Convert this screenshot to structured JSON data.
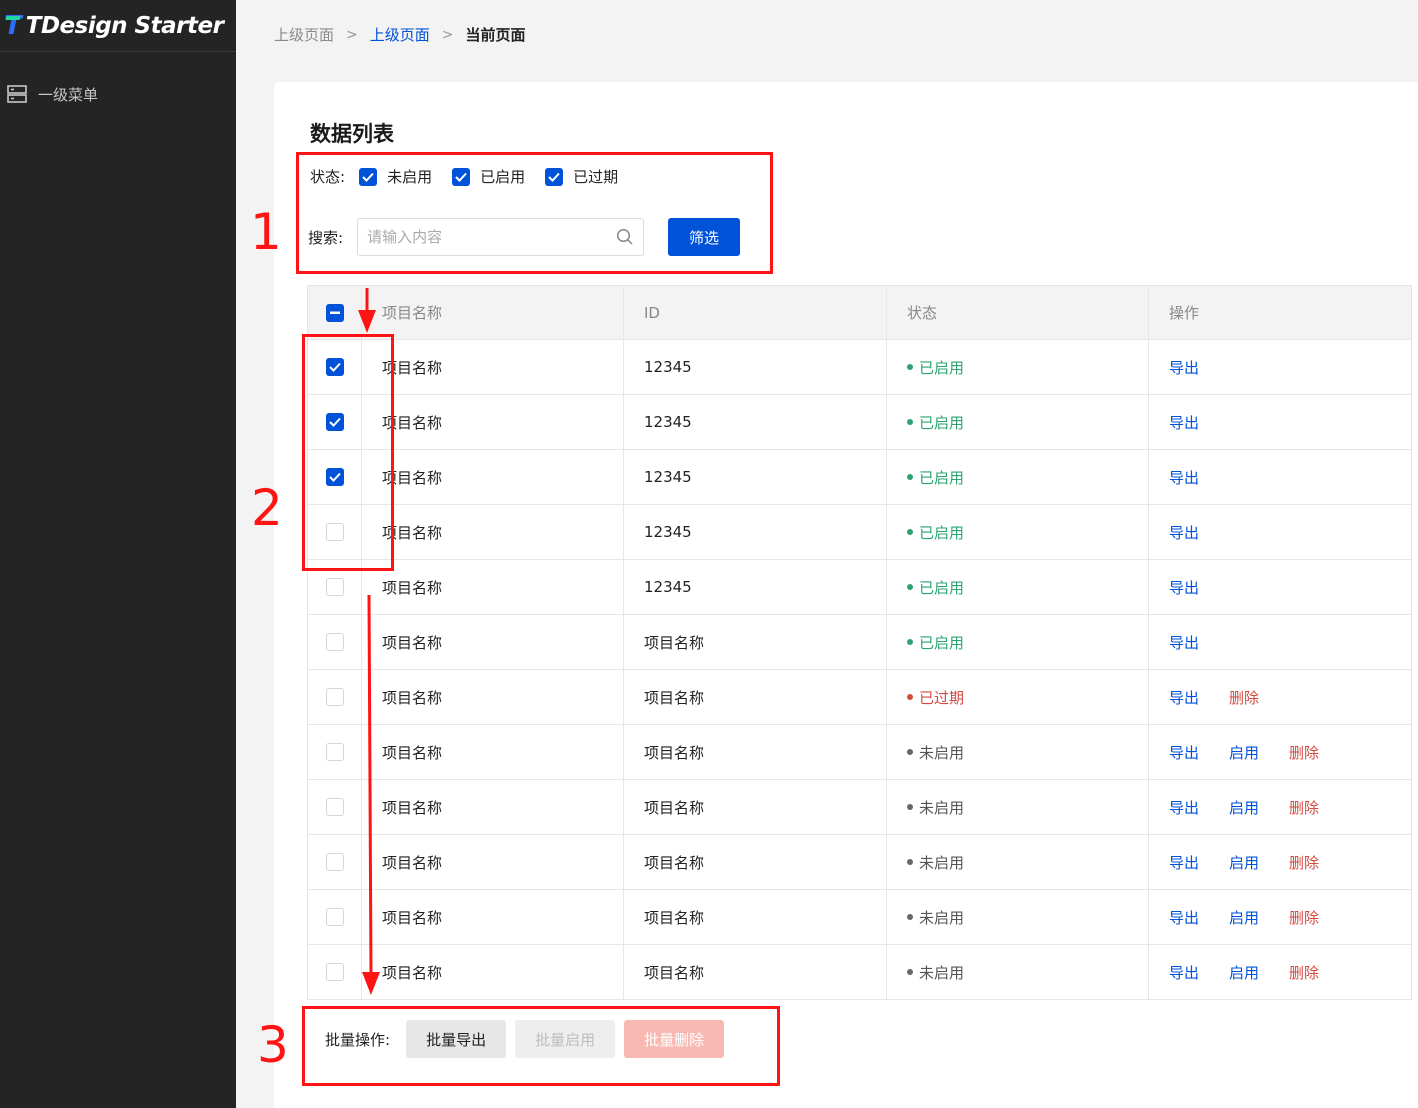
{
  "app": {
    "name": "TDesign Starter",
    "logo_mark": "T"
  },
  "sidebar": {
    "items": [
      {
        "label": "一级菜单",
        "icon": "server-icon"
      }
    ]
  },
  "breadcrumb": {
    "items": [
      "上级页面",
      "上级页面",
      "当前页面"
    ]
  },
  "page": {
    "title": "数据列表"
  },
  "filter": {
    "status_label": "状态:",
    "status_options": [
      {
        "label": "未启用",
        "checked": true
      },
      {
        "label": "已启用",
        "checked": true
      },
      {
        "label": "已过期",
        "checked": true
      }
    ],
    "search_label": "搜索:",
    "search_placeholder": "请输入内容",
    "search_value": "",
    "filter_button": "筛选"
  },
  "table": {
    "header_checkbox_state": "indeterminate",
    "columns": [
      "项目名称",
      "ID",
      "状态",
      "操作"
    ],
    "rows": [
      {
        "checked": true,
        "name": "项目名称",
        "id": "12345",
        "status": "已启用",
        "status_type": "enabled",
        "actions": [
          "导出"
        ]
      },
      {
        "checked": true,
        "name": "项目名称",
        "id": "12345",
        "status": "已启用",
        "status_type": "enabled",
        "actions": [
          "导出"
        ]
      },
      {
        "checked": true,
        "name": "项目名称",
        "id": "12345",
        "status": "已启用",
        "status_type": "enabled",
        "actions": [
          "导出"
        ]
      },
      {
        "checked": false,
        "name": "项目名称",
        "id": "12345",
        "status": "已启用",
        "status_type": "enabled",
        "actions": [
          "导出"
        ]
      },
      {
        "checked": false,
        "name": "项目名称",
        "id": "12345",
        "status": "已启用",
        "status_type": "enabled",
        "actions": [
          "导出"
        ]
      },
      {
        "checked": false,
        "name": "项目名称",
        "id": "项目名称",
        "status": "已启用",
        "status_type": "enabled",
        "actions": [
          "导出"
        ]
      },
      {
        "checked": false,
        "name": "项目名称",
        "id": "项目名称",
        "status": "已过期",
        "status_type": "expired",
        "actions": [
          "导出",
          "删除"
        ]
      },
      {
        "checked": false,
        "name": "项目名称",
        "id": "项目名称",
        "status": "未启用",
        "status_type": "disabled",
        "actions": [
          "导出",
          "启用",
          "删除"
        ]
      },
      {
        "checked": false,
        "name": "项目名称",
        "id": "项目名称",
        "status": "未启用",
        "status_type": "disabled",
        "actions": [
          "导出",
          "启用",
          "删除"
        ]
      },
      {
        "checked": false,
        "name": "项目名称",
        "id": "项目名称",
        "status": "未启用",
        "status_type": "disabled",
        "actions": [
          "导出",
          "启用",
          "删除"
        ]
      },
      {
        "checked": false,
        "name": "项目名称",
        "id": "项目名称",
        "status": "未启用",
        "status_type": "disabled",
        "actions": [
          "导出",
          "启用",
          "删除"
        ]
      },
      {
        "checked": false,
        "name": "项目名称",
        "id": "项目名称",
        "status": "未启用",
        "status_type": "disabled",
        "actions": [
          "导出",
          "启用",
          "删除"
        ]
      }
    ]
  },
  "batch": {
    "label": "批量操作:",
    "buttons": [
      {
        "label": "批量导出",
        "state": "active"
      },
      {
        "label": "批量启用",
        "state": "disabled"
      },
      {
        "label": "批量删除",
        "state": "disabled"
      }
    ]
  },
  "annotations": {
    "labels": [
      "1",
      "2",
      "3"
    ]
  },
  "colors": {
    "primary": "#0052d9",
    "success": "#2ba471",
    "danger": "#d54941",
    "annotation": "#ff1414",
    "sidebar_bg": "#242424"
  }
}
